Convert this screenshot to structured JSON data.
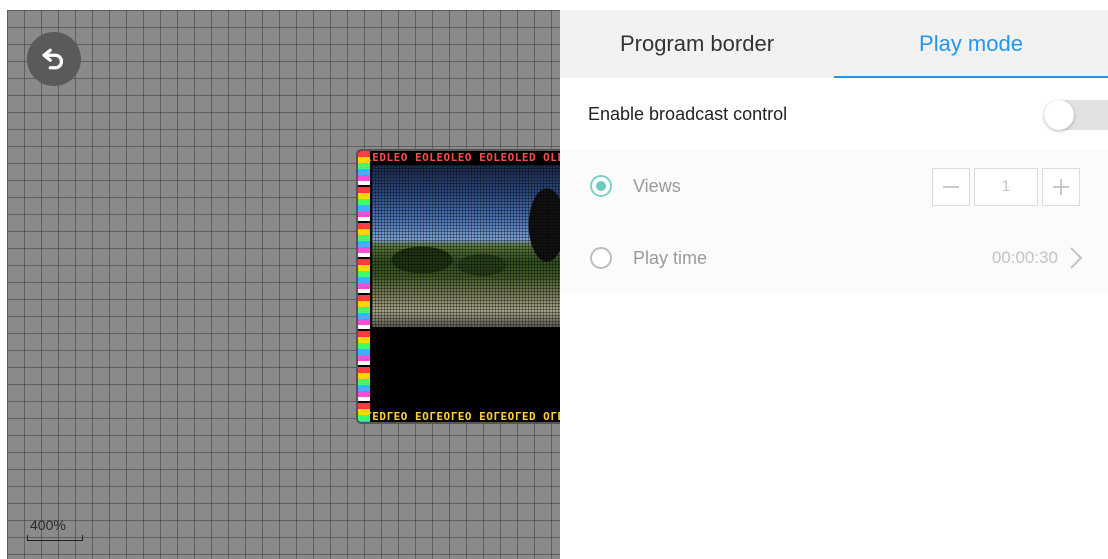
{
  "canvas": {
    "undo_icon": "undo-icon",
    "zoom_label": "400%",
    "led_border_text": "OLEDLEO EOLEOLEO EOLEOLED OLEDLEO"
  },
  "tabs": [
    {
      "label": "Program border",
      "active": false
    },
    {
      "label": "Play mode",
      "active": true
    }
  ],
  "broadcast": {
    "label": "Enable broadcast control",
    "enabled": false
  },
  "options": {
    "views": {
      "label": "Views",
      "selected": true,
      "value": "1"
    },
    "play_time": {
      "label": "Play time",
      "selected": false,
      "value": "00:00:30"
    }
  },
  "colors": {
    "accent": "#2196f3",
    "radio_checked": "#6fcabf"
  }
}
